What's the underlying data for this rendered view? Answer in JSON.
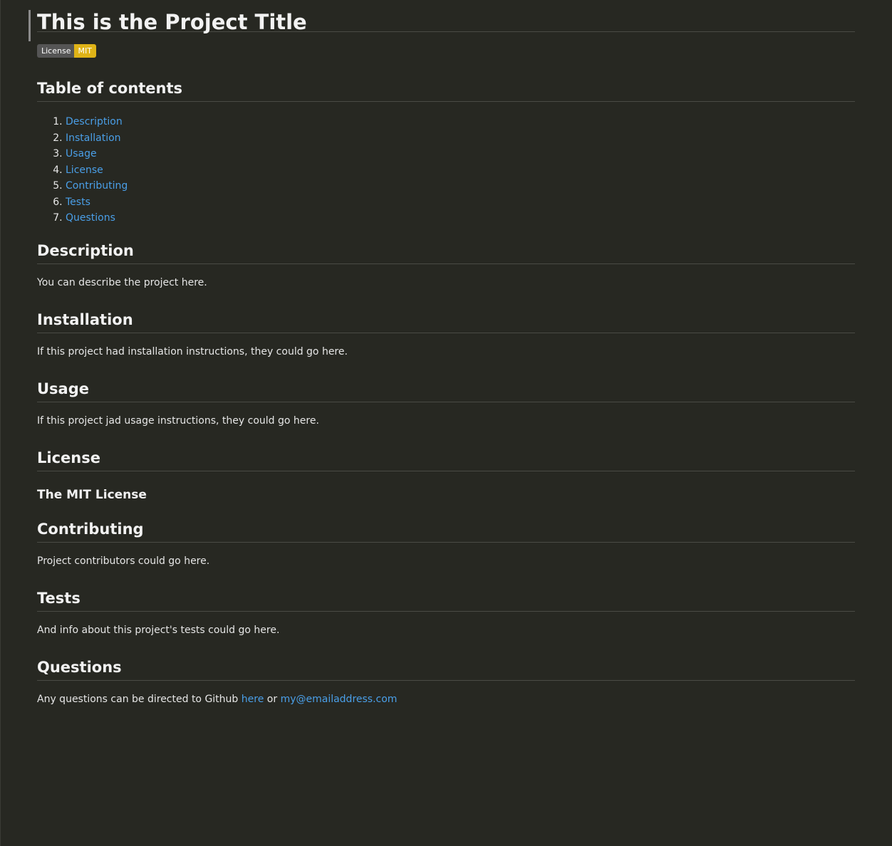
{
  "title": "This is the Project Title",
  "badge": {
    "left": "License",
    "right": "MIT"
  },
  "toc": {
    "heading": "Table of contents",
    "items": [
      "Description",
      "Installation",
      "Usage",
      "License",
      "Contributing",
      "Tests",
      "Questions"
    ]
  },
  "description": {
    "heading": "Description",
    "text": "You can describe the project here."
  },
  "installation": {
    "heading": "Installation",
    "text": "If this project had installation instructions, they could go here."
  },
  "usage": {
    "heading": "Usage",
    "text": "If this project jad usage instructions, they could go here."
  },
  "license": {
    "heading": "License",
    "subheading": "The MIT License"
  },
  "contributing": {
    "heading": "Contributing",
    "text": "Project contributors could go here."
  },
  "tests": {
    "heading": "Tests",
    "text": "And info about this project's tests could go here."
  },
  "questions": {
    "heading": "Questions",
    "text_before": "Any questions can be directed to Github",
    "link_github": "here",
    "text_middle": "or",
    "link_email": "my@emailaddress.com"
  },
  "colors": {
    "background": "#272822",
    "link": "#4a9fe8",
    "badge_left": "#555555",
    "badge_right": "#dfb317"
  }
}
